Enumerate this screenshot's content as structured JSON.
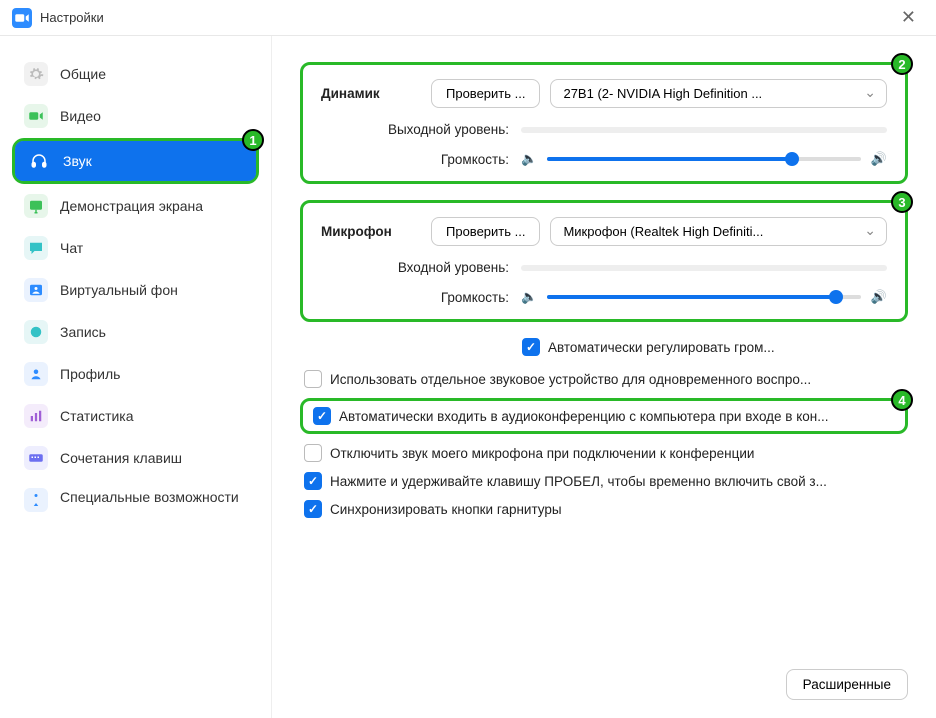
{
  "window": {
    "title": "Настройки"
  },
  "sidebar": {
    "items": [
      {
        "label": "Общие"
      },
      {
        "label": "Видео"
      },
      {
        "label": "Звук"
      },
      {
        "label": "Демонстрация экрана"
      },
      {
        "label": "Чат"
      },
      {
        "label": "Виртуальный фон"
      },
      {
        "label": "Запись"
      },
      {
        "label": "Профиль"
      },
      {
        "label": "Статистика"
      },
      {
        "label": "Сочетания клавиш"
      },
      {
        "label": "Специальные возможности"
      }
    ]
  },
  "speaker": {
    "title": "Динамик",
    "test": "Проверить ...",
    "device": "27B1 (2- NVIDIA High Definition ...",
    "output_level_label": "Выходной уровень:",
    "volume_label": "Громкость:",
    "volume_pct": 78
  },
  "mic": {
    "title": "Микрофон",
    "test": "Проверить ...",
    "device": "Микрофон (Realtek High Definiti...",
    "input_level_label": "Входной уровень:",
    "volume_label": "Громкость:",
    "volume_pct": 92,
    "auto_adjust": "Автоматически регулировать гром..."
  },
  "options": {
    "separate_device": "Использовать отдельное звуковое устройство для одновременного воспро...",
    "auto_join": "Автоматически входить в аудиоконференцию с компьютера при входе в кон...",
    "mute_on_join": "Отключить звук моего микрофона при подключении к конференции",
    "space_unmute": "Нажмите и удерживайте клавишу ПРОБЕЛ, чтобы временно включить свой з...",
    "sync_headset": "Синхронизировать кнопки гарнитуры"
  },
  "advanced": "Расширенные",
  "badges": {
    "b1": "1",
    "b2": "2",
    "b3": "3",
    "b4": "4"
  }
}
